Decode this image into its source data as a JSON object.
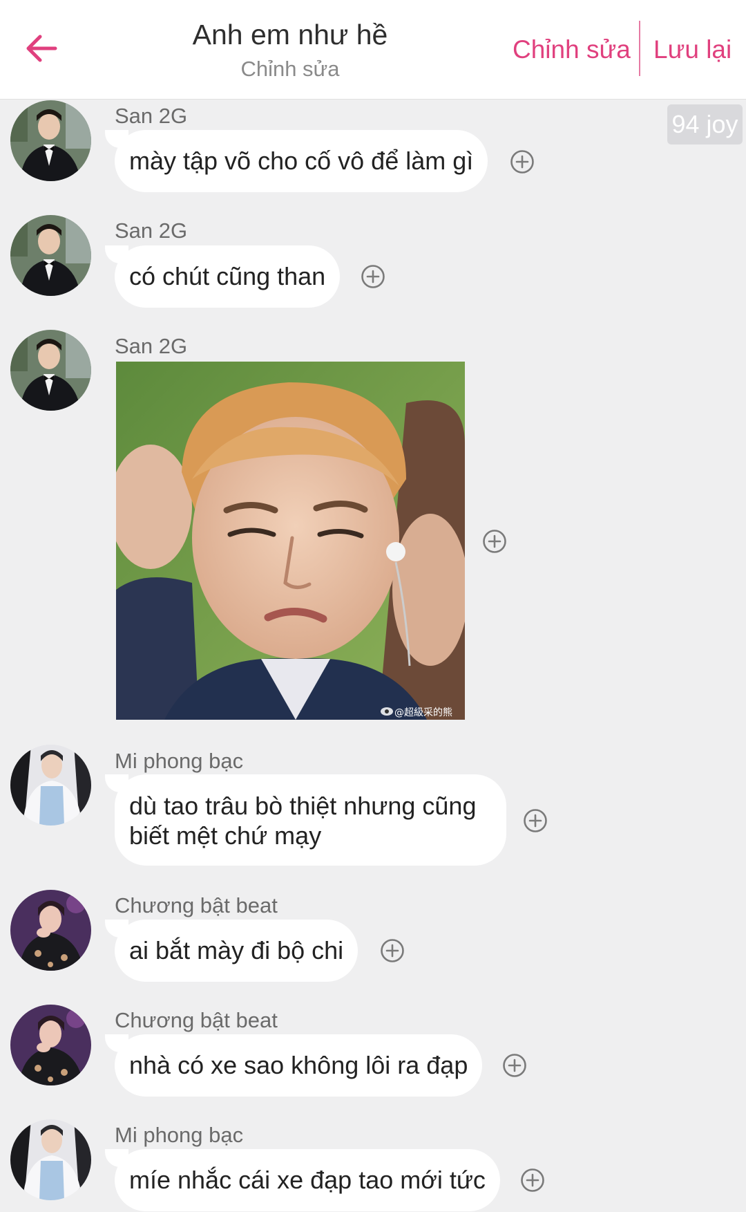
{
  "header": {
    "title": "Anh em như hề",
    "subtitle": "Chỉnh sửa",
    "edit_label": "Chỉnh sửa",
    "save_label": "Lưu lại",
    "back_icon": "arrow-left-icon",
    "accent_color": "#e0407e"
  },
  "joy_badge": "94 joy",
  "messages": [
    {
      "sender": "San 2G",
      "type": "text",
      "text": "mày tập võ cho cố vô để làm gì"
    },
    {
      "sender": "San 2G",
      "type": "text",
      "text": "có chút cũng than"
    },
    {
      "sender": "San 2G",
      "type": "image",
      "image_caption": "@超級采的熊",
      "image_source_icon": "weibo-icon"
    },
    {
      "sender": "Mi phong bạc",
      "type": "text",
      "text": "dù tao trâu bò thiệt nhưng cũng biết mệt chứ mạy"
    },
    {
      "sender": "Chương bật beat",
      "type": "text",
      "text": "ai bắt mày đi bộ chi"
    },
    {
      "sender": "Chương bật beat",
      "type": "text",
      "text": "nhà có xe sao không lôi ra đạp"
    },
    {
      "sender": "Mi phong bạc",
      "type": "text",
      "text": "míe nhắc cái xe đạp tao mới tức"
    }
  ],
  "add_icon": "add-circle-icon"
}
